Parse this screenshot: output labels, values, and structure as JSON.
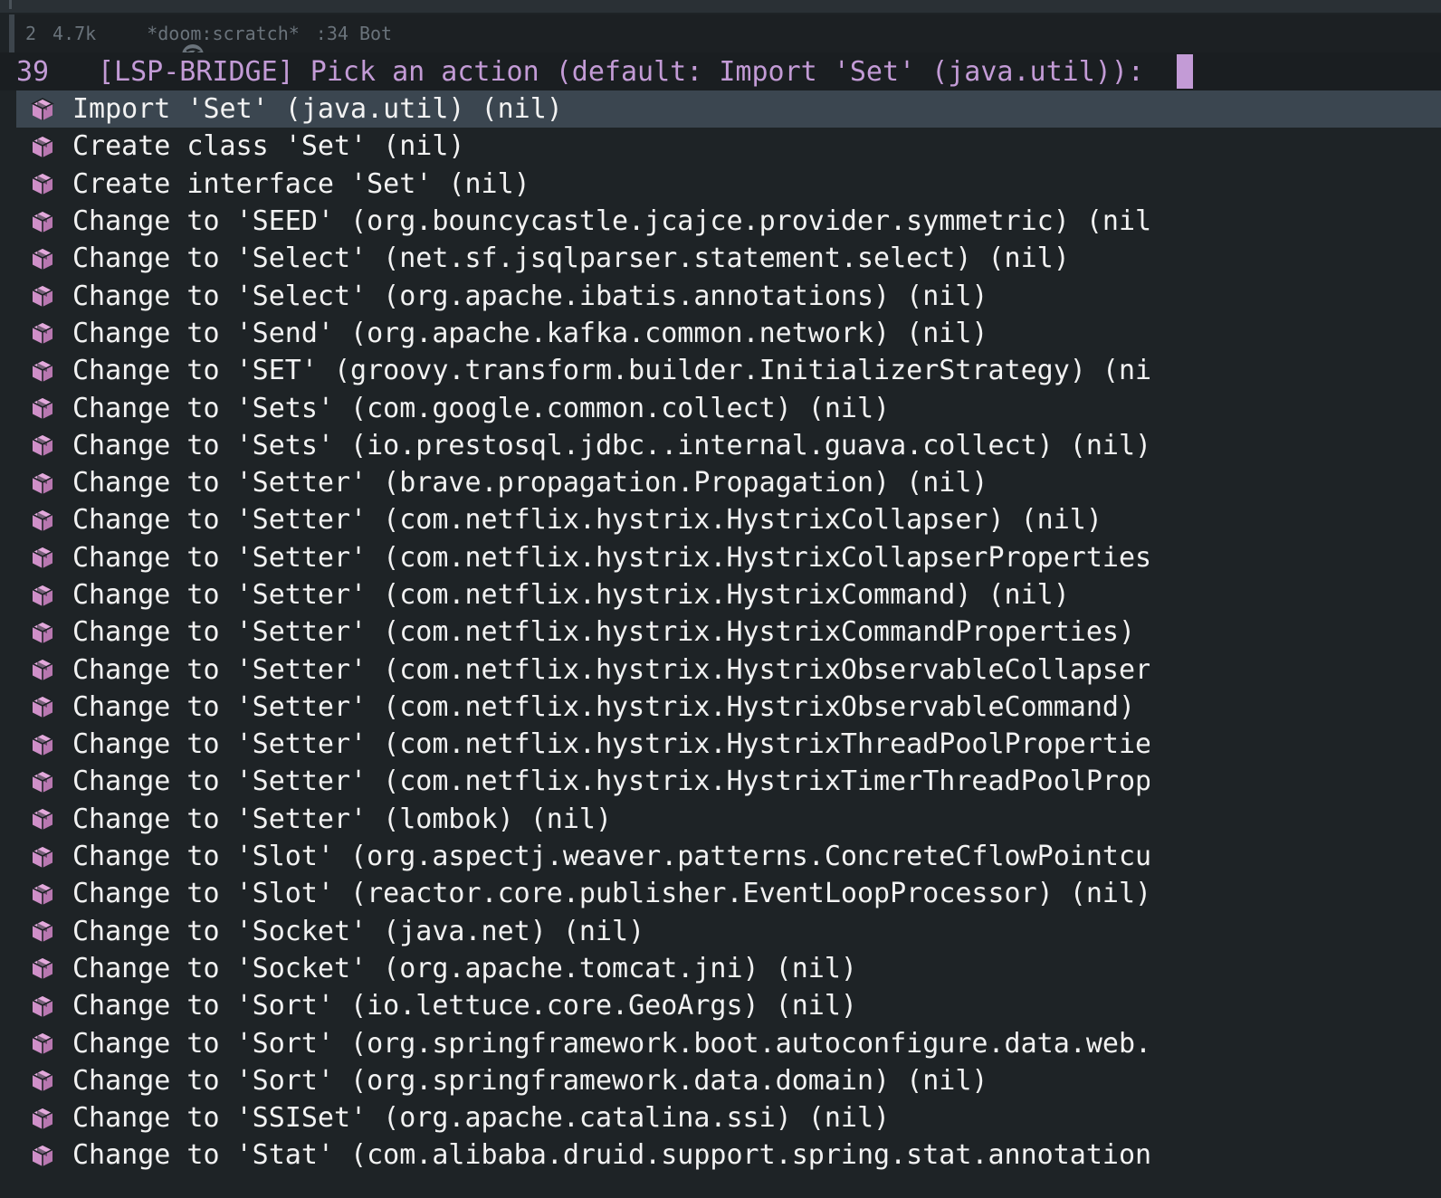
{
  "modeline": {
    "line": "2",
    "size": "4.7k",
    "buffer": "*doom:scratch*",
    "position": ":34 Bot",
    "icon": "emacs-logo-icon"
  },
  "prompt": {
    "count": "39",
    "text": "[LSP-BRIDGE] Pick an action (default: Import 'Set' (java.util)): "
  },
  "colors": {
    "accent": "#c39bd6",
    "cube": "#cf8fc8",
    "selected_bg": "#3b4650"
  },
  "candidates": [
    {
      "label": "Import 'Set' (java.util) (nil)"
    },
    {
      "label": "Create class 'Set' (nil)"
    },
    {
      "label": "Create interface 'Set' (nil)"
    },
    {
      "label": "Change to 'SEED' (org.bouncycastle.jcajce.provider.symmetric) (nil)"
    },
    {
      "label": "Change to 'Select' (net.sf.jsqlparser.statement.select) (nil)"
    },
    {
      "label": "Change to 'Select' (org.apache.ibatis.annotations) (nil)"
    },
    {
      "label": "Change to 'Send' (org.apache.kafka.common.network) (nil)"
    },
    {
      "label": "Change to 'SET' (groovy.transform.builder.InitializerStrategy) (ni…"
    },
    {
      "label": "Change to 'Sets' (com.google.common.collect) (nil)"
    },
    {
      "label": "Change to 'Sets' (io.prestosql.jdbc..internal.guava.collect) (nil)"
    },
    {
      "label": "Change to 'Setter' (brave.propagation.Propagation) (nil)"
    },
    {
      "label": "Change to 'Setter' (com.netflix.hystrix.HystrixCollapser) (nil)"
    },
    {
      "label": "Change to 'Setter' (com.netflix.hystrix.HystrixCollapserProperties…"
    },
    {
      "label": "Change to 'Setter' (com.netflix.hystrix.HystrixCommand) (nil)"
    },
    {
      "label": "Change to 'Setter' (com.netflix.hystrix.HystrixCommandProperties) …"
    },
    {
      "label": "Change to 'Setter' (com.netflix.hystrix.HystrixObservableCollapser…"
    },
    {
      "label": "Change to 'Setter' (com.netflix.hystrix.HystrixObservableCommand) …"
    },
    {
      "label": "Change to 'Setter' (com.netflix.hystrix.HystrixThreadPoolPropertie…"
    },
    {
      "label": "Change to 'Setter' (com.netflix.hystrix.HystrixTimerThreadPoolProp…"
    },
    {
      "label": "Change to 'Setter' (lombok) (nil)"
    },
    {
      "label": "Change to 'Slot' (org.aspectj.weaver.patterns.ConcreteCflowPointcu…"
    },
    {
      "label": "Change to 'Slot' (reactor.core.publisher.EventLoopProcessor) (nil)"
    },
    {
      "label": "Change to 'Socket' (java.net) (nil)"
    },
    {
      "label": "Change to 'Socket' (org.apache.tomcat.jni) (nil)"
    },
    {
      "label": "Change to 'Sort' (io.lettuce.core.GeoArgs) (nil)"
    },
    {
      "label": "Change to 'Sort' (org.springframework.boot.autoconfigure.data.web.…"
    },
    {
      "label": "Change to 'Sort' (org.springframework.data.domain) (nil)"
    },
    {
      "label": "Change to 'SSISet' (org.apache.catalina.ssi) (nil)"
    },
    {
      "label": "Change to 'Stat' (com.alibaba.druid.support.spring.stat.annotation…"
    }
  ],
  "selected_index": 0
}
